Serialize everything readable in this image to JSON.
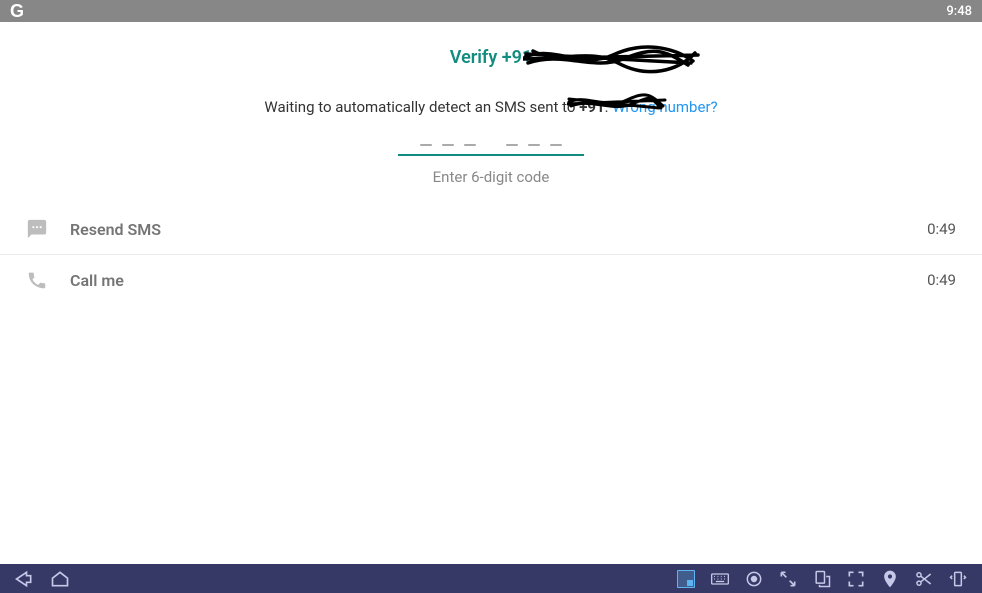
{
  "statusBar": {
    "logo": "G",
    "time": "9:48"
  },
  "header": {
    "titlePrefix": "Verify ",
    "titlePhone": "+91"
  },
  "subtitle": {
    "prefix": "Waiting to automatically detect an SMS sent to ",
    "phone": "+91",
    "suffix": ". ",
    "wrongNumber": "Wrong number?"
  },
  "code": {
    "hint": "Enter 6-digit code"
  },
  "options": {
    "resend": {
      "label": "Resend SMS",
      "timer": "0:49"
    },
    "call": {
      "label": "Call me",
      "timer": "0:49"
    }
  }
}
